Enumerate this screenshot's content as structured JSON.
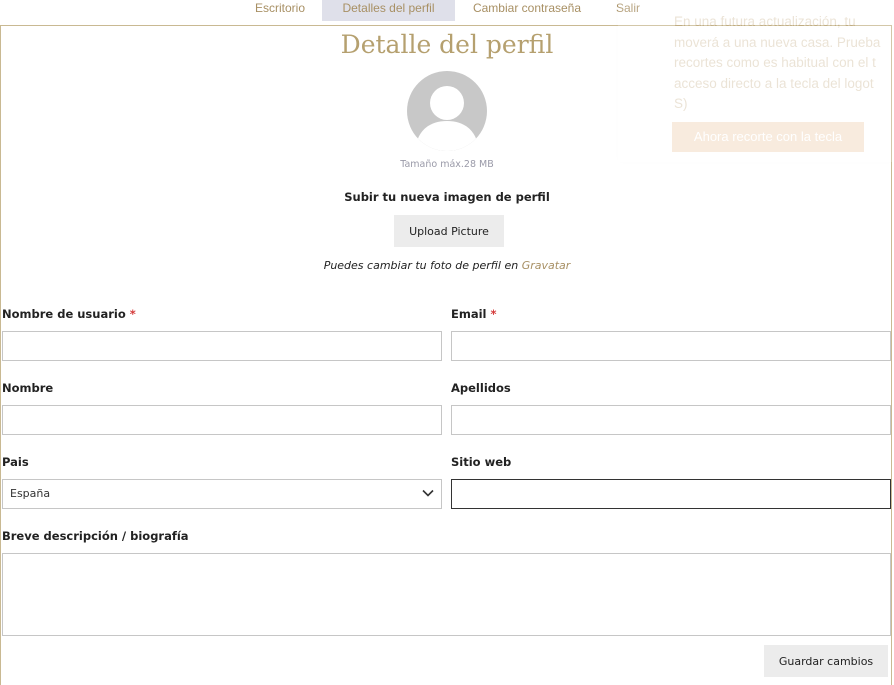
{
  "tabs": [
    {
      "label": "Escritorio"
    },
    {
      "label": "Detalles del perfil",
      "active": true
    },
    {
      "label": "Cambiar contraseña"
    },
    {
      "label": "Salir"
    }
  ],
  "notice": {
    "text": "En una futura actualización, tu\nmoverá a una nueva casa. Prueba\nrecortes como es habitual con el t\nacceso directo a la tecla del logot\nS)",
    "button_label": "Ahora recorte con la tecla"
  },
  "profile": {
    "title": "Detalle del perfil",
    "max_size": "Tamaño máx.28 MB",
    "upload_title": "Subir tu nueva imagen de perfil",
    "upload_button": "Upload Picture",
    "gravatar_prefix": "Puedes cambiar tu foto de perfil en ",
    "gravatar_link": "Gravatar"
  },
  "form": {
    "username_label": "Nombre de usuario",
    "email_label": "Email",
    "first_name_label": "Nombre",
    "last_name_label": "Apellidos",
    "country_label": "Pais",
    "country_value": "España",
    "website_label": "Sitio web",
    "bio_label": "Breve descripción / biografía",
    "required_mark": "*",
    "save_button": "Guardar cambios"
  },
  "colors": {
    "accent": "#a89064",
    "title": "#b5a06f",
    "required": "#d43a3a"
  },
  "icons": {
    "avatar": "user-silhouette-icon",
    "select_arrow": "chevron-down-icon"
  }
}
